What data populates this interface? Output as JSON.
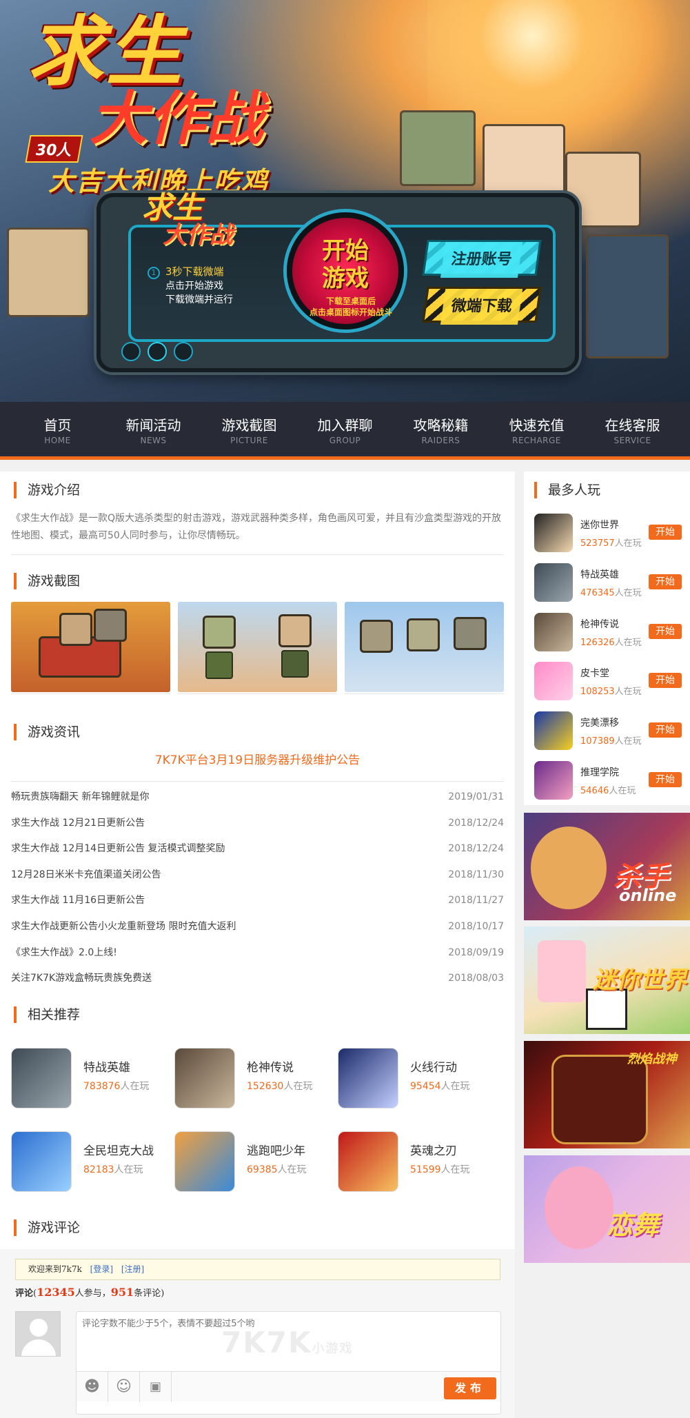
{
  "banner": {
    "logo_big_line1": "求生",
    "logo_big_line2": "大作战",
    "badge": "30人",
    "slogan": "大吉大利晚上吃鸡",
    "logo_small_line1": "求生",
    "logo_small_line2": "大作战",
    "step_num": "1",
    "step_title": "3秒下载微端",
    "step_line2": "点击开始游戏",
    "step_line3": "下载微端并运行",
    "start_line1": "开始",
    "start_line2": "游戏",
    "start_hint1": "下载至桌面后",
    "start_hint2": "点击桌面图标开始战斗",
    "register_label": "注册账号",
    "download_label": "微端下载"
  },
  "nav": [
    {
      "cn": "首页",
      "en": "HOME"
    },
    {
      "cn": "新闻活动",
      "en": "NEWS"
    },
    {
      "cn": "游戏截图",
      "en": "PICTURE"
    },
    {
      "cn": "加入群聊",
      "en": "GROUP"
    },
    {
      "cn": "攻略秘籍",
      "en": "RAIDERS"
    },
    {
      "cn": "快速充值",
      "en": "RECHARGE"
    },
    {
      "cn": "在线客服",
      "en": "SERVICE"
    }
  ],
  "intro": {
    "title": "游戏介绍",
    "text": "《求生大作战》是一款Q版大逃杀类型的射击游戏，游戏武器种类多样，角色画风可爱，并且有沙盒类型游戏的开放性地图、模式，最高可50人同时参与，让你尽情畅玩。"
  },
  "screens": {
    "title": "游戏截图"
  },
  "news": {
    "title": "游戏资讯",
    "headline": "7K7K平台3月19日服务器升级维护公告",
    "items": [
      {
        "t": "畅玩贵族嗨翻天 新年锦鲤就是你",
        "d": "2019/01/31"
      },
      {
        "t": "求生大作战 12月21日更新公告",
        "d": "2018/12/24"
      },
      {
        "t": "求生大作战 12月14日更新公告 复活模式调整奖励",
        "d": "2018/12/24"
      },
      {
        "t": "12月28日米米卡充值渠道关闭公告",
        "d": "2018/11/30"
      },
      {
        "t": "求生大作战 11月16日更新公告",
        "d": "2018/11/27"
      },
      {
        "t": "求生大作战更新公告小火龙重新登场 限时充值大返利",
        "d": "2018/10/17"
      },
      {
        "t": "《求生大作战》2.0上线!",
        "d": "2018/09/19"
      },
      {
        "t": "关注7K7K游戏盒畅玩贵族免费送",
        "d": "2018/08/03"
      }
    ]
  },
  "recommend": {
    "title": "相关推荐",
    "suffix": "人在玩",
    "items": [
      {
        "name": "特战英雄",
        "count": "783876"
      },
      {
        "name": "枪神传说",
        "count": "152630"
      },
      {
        "name": "火线行动",
        "count": "95454"
      },
      {
        "name": "全民坦克大战",
        "count": "82183"
      },
      {
        "name": "逃跑吧少年",
        "count": "69385"
      },
      {
        "name": "英魂之刃",
        "count": "51599"
      }
    ]
  },
  "comments": {
    "title": "游戏评论",
    "welcome": "欢迎来到7k7k",
    "login": "[登录]",
    "register": "[注册]",
    "label": "评论",
    "participants": "12345",
    "participants_suffix": "人参与，",
    "count": "951",
    "count_suffix": "条评论)",
    "open_paren": "(",
    "placeholder": "评论字数不能少于5个，表情不要超过5个哟",
    "watermark": "7K7K",
    "watermark_small": "小游戏",
    "publish": "发布"
  },
  "hot": {
    "title": "最多人玩",
    "suffix": "人在玩",
    "button": "开始",
    "items": [
      {
        "name": "迷你世界",
        "count": "523757"
      },
      {
        "name": "特战英雄",
        "count": "476345"
      },
      {
        "name": "枪神传说",
        "count": "126326"
      },
      {
        "name": "皮卡堂",
        "count": "108253"
      },
      {
        "name": "完美漂移",
        "count": "107389"
      },
      {
        "name": "推理学院",
        "count": "54646"
      }
    ]
  },
  "ads": {
    "ad1": "杀手",
    "ad1_sub": "online",
    "ad2": "迷你世界",
    "ad3": "烈焰战神",
    "ad4": "恋舞"
  },
  "colors": {
    "accent": "#f26a1b",
    "nav_bg": "#282b35"
  }
}
